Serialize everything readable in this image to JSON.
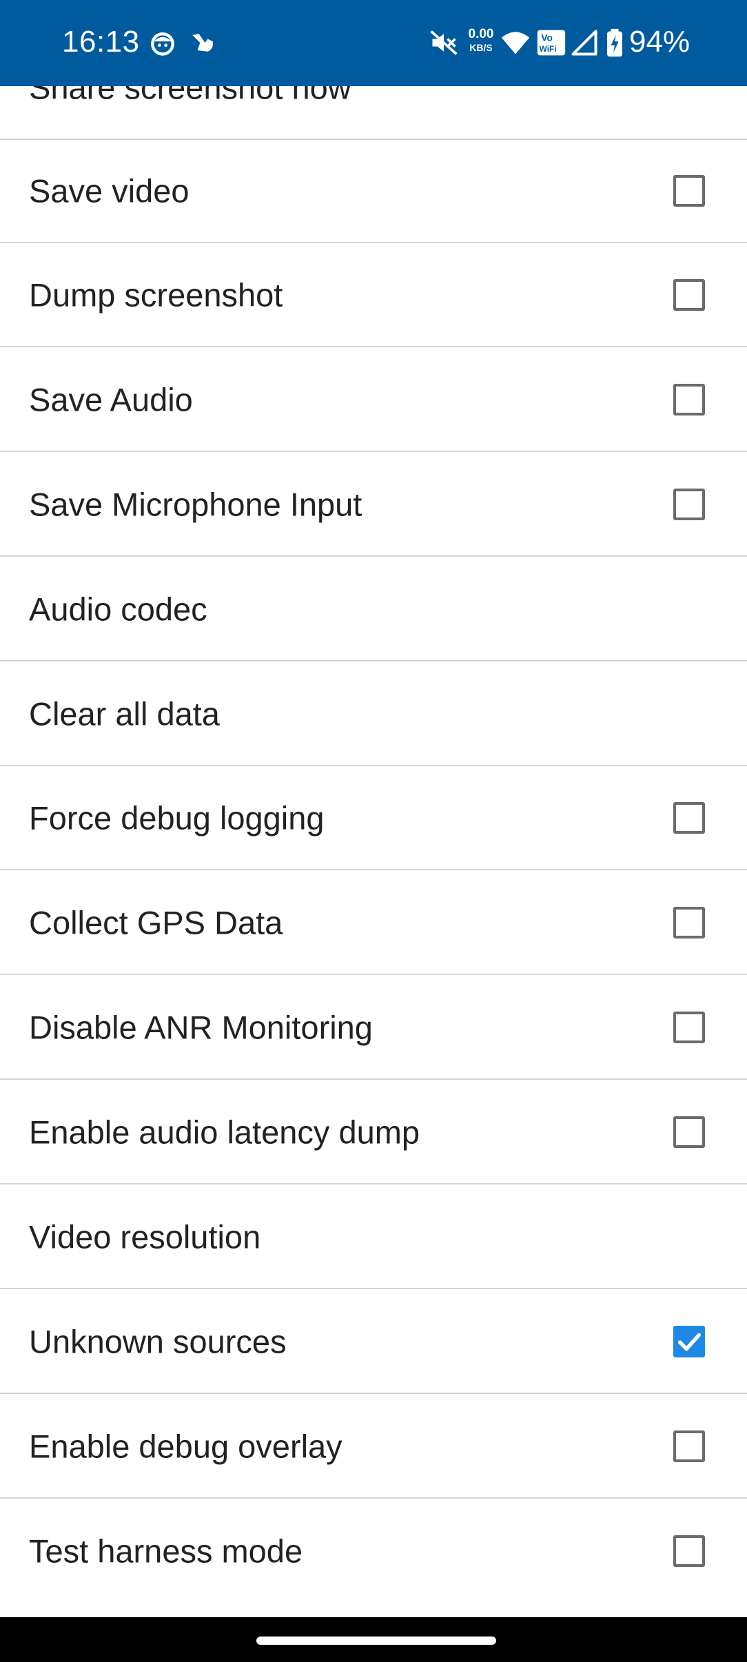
{
  "status_bar": {
    "time": "16:13",
    "net_speed_value": "0.00",
    "net_speed_unit": "KB/S",
    "battery_percent": "94%",
    "background": "#005a9e",
    "icons": [
      "face-icon",
      "bird-icon",
      "mute-icon",
      "wifi-icon",
      "vowifi-icon",
      "signal-icon",
      "battery-charging-icon"
    ],
    "vowifi_top": "Vo",
    "vowifi_bottom": "WiFi"
  },
  "settings": {
    "items": [
      {
        "label": "Share screenshot now",
        "type": "action"
      },
      {
        "label": "Save video",
        "type": "checkbox",
        "checked": false
      },
      {
        "label": "Dump screenshot",
        "type": "checkbox",
        "checked": false
      },
      {
        "label": "Save Audio",
        "type": "checkbox",
        "checked": false
      },
      {
        "label": "Save Microphone Input",
        "type": "checkbox",
        "checked": false
      },
      {
        "label": "Audio codec",
        "type": "action"
      },
      {
        "label": "Clear all data",
        "type": "action"
      },
      {
        "label": "Force debug logging",
        "type": "checkbox",
        "checked": false
      },
      {
        "label": "Collect GPS Data",
        "type": "checkbox",
        "checked": false
      },
      {
        "label": "Disable ANR Monitoring",
        "type": "checkbox",
        "checked": false
      },
      {
        "label": "Enable audio latency dump",
        "type": "checkbox",
        "checked": false
      },
      {
        "label": "Video resolution",
        "type": "action"
      },
      {
        "label": "Unknown sources",
        "type": "checkbox",
        "checked": true
      },
      {
        "label": "Enable debug overlay",
        "type": "checkbox",
        "checked": false
      },
      {
        "label": "Test harness mode",
        "type": "checkbox",
        "checked": false
      }
    ],
    "checked_color": "#1e88e5"
  }
}
